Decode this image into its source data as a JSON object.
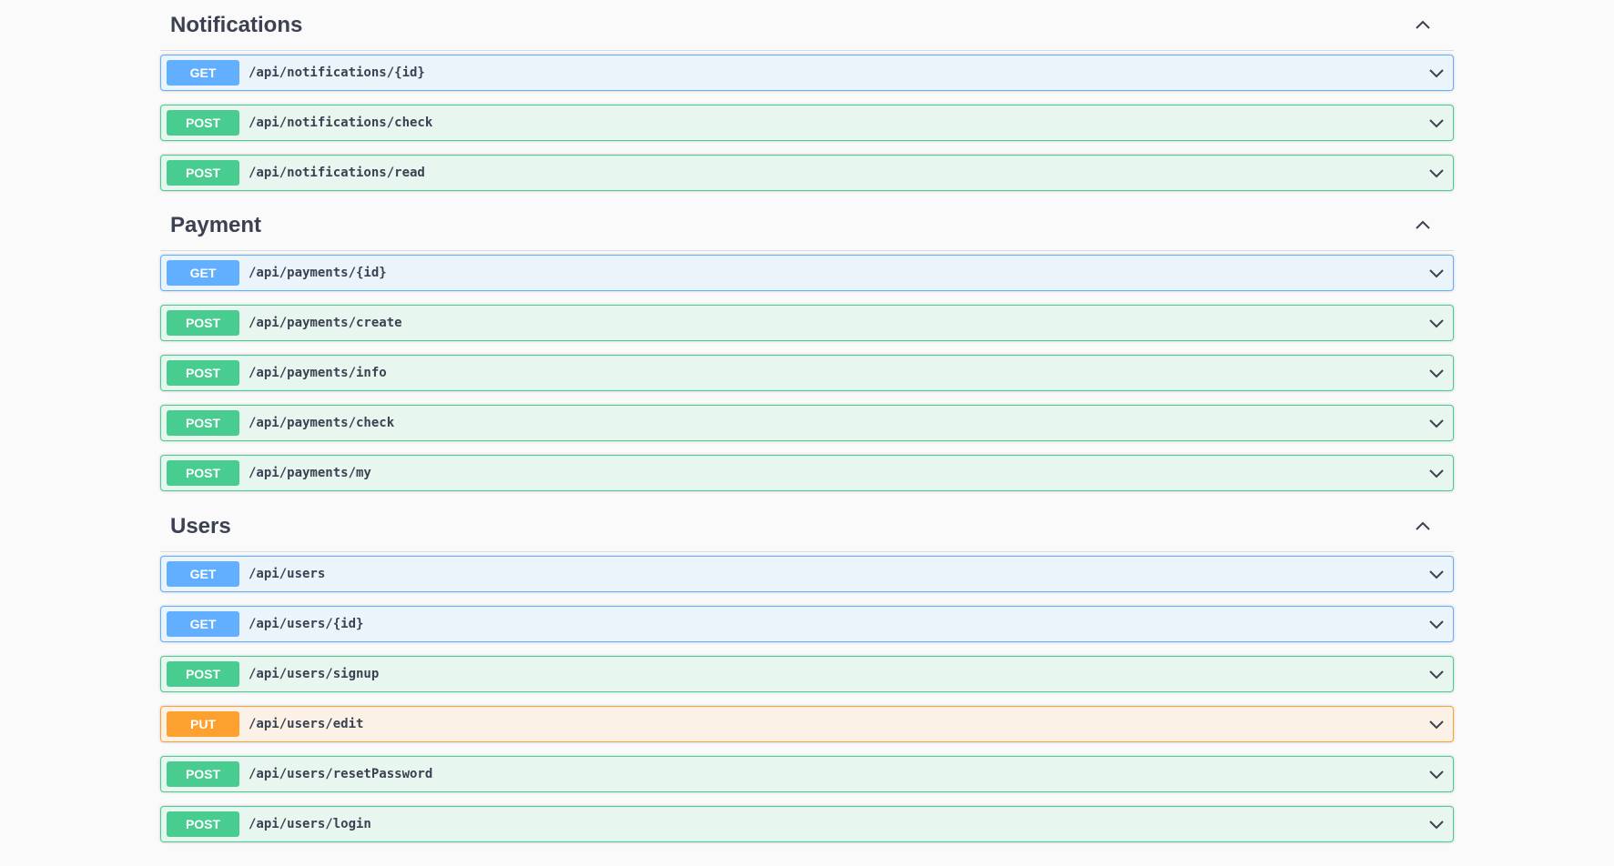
{
  "sections": [
    {
      "title": "Notifications",
      "toggle_icon": "chevron-up-icon",
      "operations": [
        {
          "method": "GET",
          "path": "/api/notifications/{id}"
        },
        {
          "method": "POST",
          "path": "/api/notifications/check"
        },
        {
          "method": "POST",
          "path": "/api/notifications/read"
        }
      ]
    },
    {
      "title": "Payment",
      "toggle_icon": "chevron-up-icon",
      "operations": [
        {
          "method": "GET",
          "path": "/api/payments/{id}"
        },
        {
          "method": "POST",
          "path": "/api/payments/create"
        },
        {
          "method": "POST",
          "path": "/api/payments/info"
        },
        {
          "method": "POST",
          "path": "/api/payments/check"
        },
        {
          "method": "POST",
          "path": "/api/payments/my"
        }
      ]
    },
    {
      "title": "Users",
      "toggle_icon": "chevron-up-icon",
      "operations": [
        {
          "method": "GET",
          "path": "/api/users"
        },
        {
          "method": "GET",
          "path": "/api/users/{id}"
        },
        {
          "method": "POST",
          "path": "/api/users/signup"
        },
        {
          "method": "PUT",
          "path": "/api/users/edit"
        },
        {
          "method": "POST",
          "path": "/api/users/resetPassword"
        },
        {
          "method": "POST",
          "path": "/api/users/login"
        }
      ]
    }
  ],
  "colors": {
    "get": "#61affe",
    "post": "#49cc90",
    "put": "#fca130"
  },
  "operation_expand_icon": "chevron-down-icon"
}
